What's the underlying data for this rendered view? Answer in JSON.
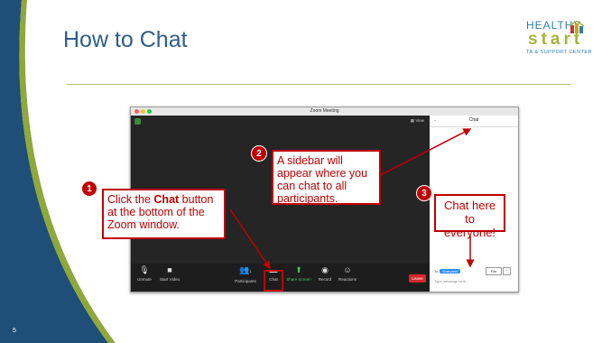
{
  "slide": {
    "title": "How to Chat",
    "number": "5",
    "logo": {
      "line1": "HEALTHY",
      "line2": "start",
      "line3": "TA & SUPPORT CENTER"
    }
  },
  "zoom": {
    "window_title": "Zoom Meeting",
    "view_label": "View",
    "toolbar": {
      "unmute": "Unmute",
      "start_video": "Start Video",
      "participants": "Participants",
      "participants_count": "1",
      "chat": "Chat",
      "share_screen": "Share Screen",
      "record": "Record",
      "reactions": "Reactions",
      "leave": "Leave"
    },
    "chat_panel": {
      "header": "Chat",
      "to_label": "To:",
      "recipient": "Everyone",
      "file_label": "File",
      "more_label": "···",
      "message_placeholder": "Type message here..."
    }
  },
  "callouts": {
    "step1": {
      "number": "1",
      "text_before": "Click the ",
      "text_bold": "Chat",
      "text_after": " button at the bottom of the Zoom window."
    },
    "step2": {
      "number": "2",
      "text": "A sidebar will appear where you can chat to all participants."
    },
    "step3": {
      "number": "3",
      "text": "Chat here to everyone!"
    }
  },
  "colors": {
    "accent_red": "#c00000",
    "title_blue": "#2e5c8a",
    "left_band_blue": "#1f4e79",
    "left_band_green": "#8ea83a",
    "zoom_blue": "#2d8cff",
    "leave_red": "#d9292b"
  }
}
